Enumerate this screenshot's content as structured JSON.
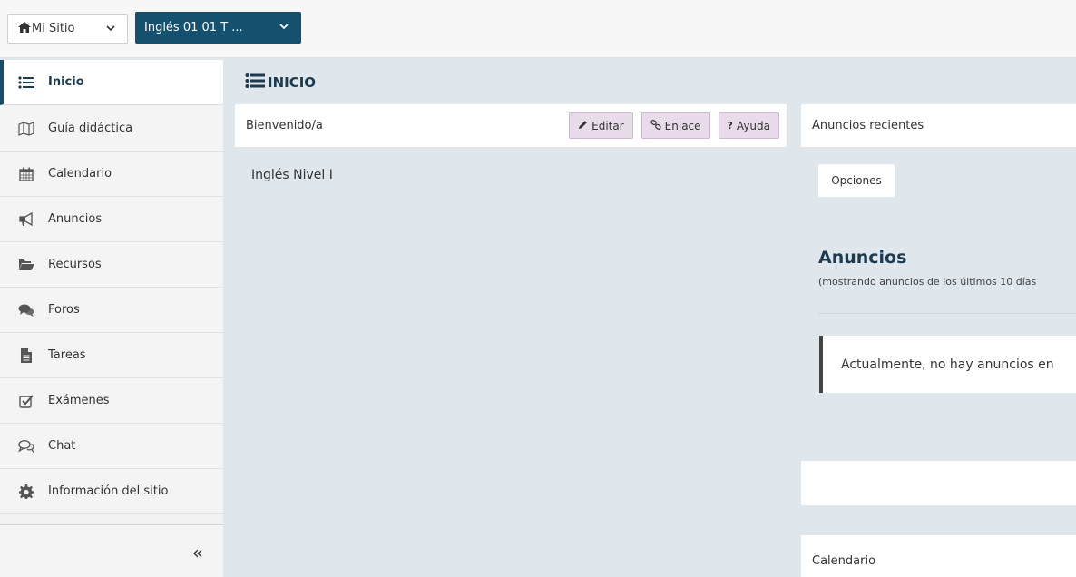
{
  "topbar": {
    "site_label": "Mi Sitio",
    "course_label": "Inglés 01 01 T ..."
  },
  "sidebar": {
    "items": [
      {
        "label": "Inicio",
        "icon": "list-icon"
      },
      {
        "label": "Guía didáctica",
        "icon": "map-icon"
      },
      {
        "label": "Calendario",
        "icon": "calendar-icon"
      },
      {
        "label": "Anuncios",
        "icon": "megaphone-icon"
      },
      {
        "label": "Recursos",
        "icon": "folder-open-icon"
      },
      {
        "label": "Foros",
        "icon": "comments-icon"
      },
      {
        "label": "Tareas",
        "icon": "file-icon"
      },
      {
        "label": "Exámenes",
        "icon": "checkbox-icon"
      },
      {
        "label": "Chat",
        "icon": "chat-bubbles-icon"
      },
      {
        "label": "Información del sitio",
        "icon": "gear-icon"
      }
    ],
    "collapse_glyph": "«"
  },
  "main": {
    "page_title": "INICIO",
    "welcome": {
      "title": "Bienvenido/a",
      "edit_label": "Editar",
      "link_label": "Enlace",
      "help_label": "Ayuda",
      "body": "Inglés Nivel I"
    },
    "announcements": {
      "title": "Anuncios recientes",
      "options_label": "Opciones",
      "heading": "Anuncios",
      "subtitle": "(mostrando anuncios de los últimos 10 días",
      "notice": "Actualmente, no hay anuncios en"
    },
    "calendar": {
      "title": "Calendario"
    }
  },
  "colors": {
    "accent": "#15516f",
    "background": "#dfe6ec",
    "tool_button": "#e8dceb"
  }
}
